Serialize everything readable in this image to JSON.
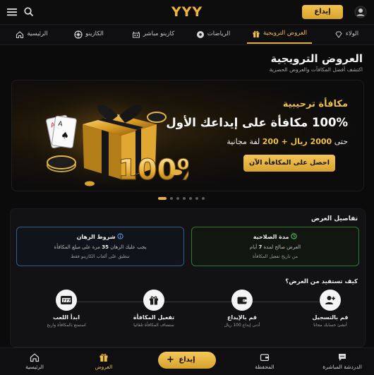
{
  "header": {
    "logo": "YYY",
    "deposit_label": "إيداع",
    "icons": [
      "menu-icon",
      "search-icon"
    ]
  },
  "nav": {
    "items": [
      {
        "label": "الولاء",
        "icon": "diamond-icon"
      },
      {
        "label": "العروض الترويجية",
        "icon": "gift-icon",
        "active": true
      },
      {
        "label": "الرياضات",
        "icon": "soccer-ball-icon"
      },
      {
        "label": "كازينو مباشر",
        "icon": "live-casino-icon"
      },
      {
        "label": "الكازينو",
        "icon": "roulette-icon"
      },
      {
        "label": "الرئيسية",
        "icon": "home-icon"
      }
    ]
  },
  "page": {
    "title": "العروض الترويجية",
    "subtitle": "اكتشف أفضل المكافآت والعروض الحصرية"
  },
  "banner": {
    "tag": "مكافأة ترحيبية",
    "headline": "100% مكافأة على إيداعك الأول",
    "detail_prefix": "حتى",
    "detail_amount": "2000 ريال + 200",
    "detail_suffix": "لفة مجانية",
    "cta": "احصل على المكافأة الآن",
    "art_text": "100%",
    "slide_count": 7,
    "active_slide": 0
  },
  "details": {
    "title": "تفاصيل العرض",
    "validity": {
      "title": "مدة الصلاحية",
      "line1_prefix": "العرض صالح لمدة",
      "line1_value": "7",
      "line1_suffix": "أيام",
      "line2": "من تاريخ تفعيل المكافأة"
    },
    "wagering": {
      "title": "شروط الرهان",
      "line1_prefix": "يجب عليك الرهان",
      "line1_value": "35",
      "line1_suffix": "مرة على مبلغ المكافأة",
      "line2": "تنطبق على ألعاب الكازينو فقط"
    },
    "how_title": "كيف تستفيد من العرض؟",
    "steps": [
      {
        "title": "قم بالتسجيل",
        "desc": "أنشئ حسابك مجانا",
        "icon": "user-plus-icon"
      },
      {
        "title": "قم بالإيداع",
        "desc": "أدنى إيداع 100 ريال",
        "icon": "wallet-icon"
      },
      {
        "title": "تفعيل المكافأة",
        "desc": "ستضاف المكافأة تلقائيا",
        "icon": "gift-icon"
      },
      {
        "title": "ابدأ اللعب",
        "desc": "استمتع بالمكافأة واربح",
        "icon": "slot-777-icon"
      }
    ]
  },
  "bottom_nav": {
    "items": [
      {
        "label": "الدردشة المباشرة",
        "icon": "chat-icon"
      },
      {
        "label": "المحفظة",
        "icon": "wallet-icon"
      },
      {
        "label": "العروض",
        "icon": "gift-icon",
        "active": true
      },
      {
        "label": "الرئيسية",
        "icon": "home-icon"
      }
    ],
    "deposit_label": "إيداع",
    "deposit_plus": "+"
  },
  "colors": {
    "accent": "#e9b53c",
    "background": "#0b0b0c",
    "green_border": "#2f7a33",
    "blue_border": "#2f5b8e"
  }
}
